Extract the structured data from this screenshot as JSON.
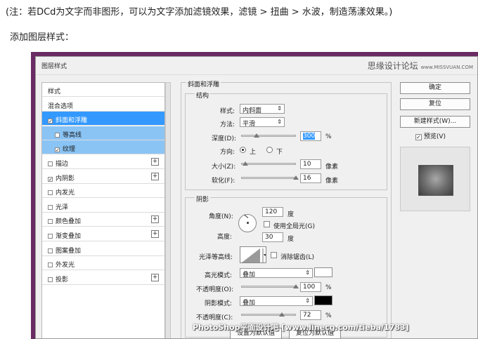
{
  "note": "(注：若DCd为文字而非图形，可以为文字添加滤镜效果，滤镜 > 扭曲 > 水波，制造荡漾效果。)",
  "subhead": "添加图层样式：",
  "dialog": {
    "title": "图层样式",
    "watermark": "思缘设计论坛",
    "watermark_url": "www.MISSVUAN.COM"
  },
  "style_list": [
    {
      "label": "样式",
      "checkbox": false,
      "checked": false,
      "plus": false,
      "state": "normal"
    },
    {
      "label": "混合选项",
      "checkbox": false,
      "checked": false,
      "plus": false,
      "state": "normal"
    },
    {
      "label": "斜面和浮雕",
      "checkbox": true,
      "checked": true,
      "plus": false,
      "state": "selected"
    },
    {
      "label": "等高线",
      "checkbox": true,
      "checked": false,
      "plus": false,
      "state": "sub"
    },
    {
      "label": "纹理",
      "checkbox": true,
      "checked": true,
      "plus": false,
      "state": "sub"
    },
    {
      "label": "描边",
      "checkbox": true,
      "checked": false,
      "plus": true,
      "state": "normal"
    },
    {
      "label": "内阴影",
      "checkbox": true,
      "checked": true,
      "plus": true,
      "state": "normal"
    },
    {
      "label": "内发光",
      "checkbox": true,
      "checked": false,
      "plus": false,
      "state": "normal"
    },
    {
      "label": "光泽",
      "checkbox": true,
      "checked": false,
      "plus": false,
      "state": "normal"
    },
    {
      "label": "颜色叠加",
      "checkbox": true,
      "checked": false,
      "plus": true,
      "state": "normal"
    },
    {
      "label": "渐变叠加",
      "checkbox": true,
      "checked": false,
      "plus": true,
      "state": "normal"
    },
    {
      "label": "图案叠加",
      "checkbox": true,
      "checked": false,
      "plus": false,
      "state": "normal"
    },
    {
      "label": "外发光",
      "checkbox": true,
      "checked": false,
      "plus": false,
      "state": "normal"
    },
    {
      "label": "投影",
      "checkbox": true,
      "checked": false,
      "plus": true,
      "state": "normal"
    }
  ],
  "bevel": {
    "section_title": "斜面和浮雕",
    "structure_title": "结构",
    "style_label": "样式:",
    "style_value": "内斜面",
    "technique_label": "方法:",
    "technique_value": "平滑",
    "depth_label": "深度(D):",
    "depth_value": "300",
    "depth_unit": "%",
    "direction_label": "方向:",
    "direction_up": "上",
    "direction_down": "下",
    "size_label": "大小(Z):",
    "size_value": "10",
    "size_unit": "像素",
    "soften_label": "软化(F):",
    "soften_value": "16",
    "soften_unit": "像素",
    "shading_title": "阴影",
    "angle_label": "角度(N):",
    "angle_value": "120",
    "angle_unit": "度",
    "global_light_label": "使用全局光(G)",
    "altitude_label": "高度:",
    "altitude_value": "30",
    "altitude_unit": "度",
    "gloss_label": "光泽等高线:",
    "antialias_label": "消除锯齿(L)",
    "highlight_mode_label": "高光模式:",
    "highlight_mode_value": "叠加",
    "highlight_opacity_label": "不透明度(O):",
    "highlight_opacity_value": "100",
    "highlight_opacity_unit": "%",
    "shadow_mode_label": "阴影模式:",
    "shadow_mode_value": "叠加",
    "shadow_opacity_label": "不透明度(C):",
    "shadow_opacity_value": "72",
    "shadow_opacity_unit": "%",
    "set_default": "设置为默认值",
    "reset_default": "复位为默认值",
    "highlight_color": "#ffffff",
    "shadow_color": "#000000"
  },
  "buttons": {
    "ok": "确定",
    "reset": "复位",
    "new_style": "新建样式(W)...",
    "preview_check": "✓",
    "preview": "预览(V)"
  },
  "credit": "PhotoShop平面设计吧 [www.linecg.com/tieba/1783]"
}
